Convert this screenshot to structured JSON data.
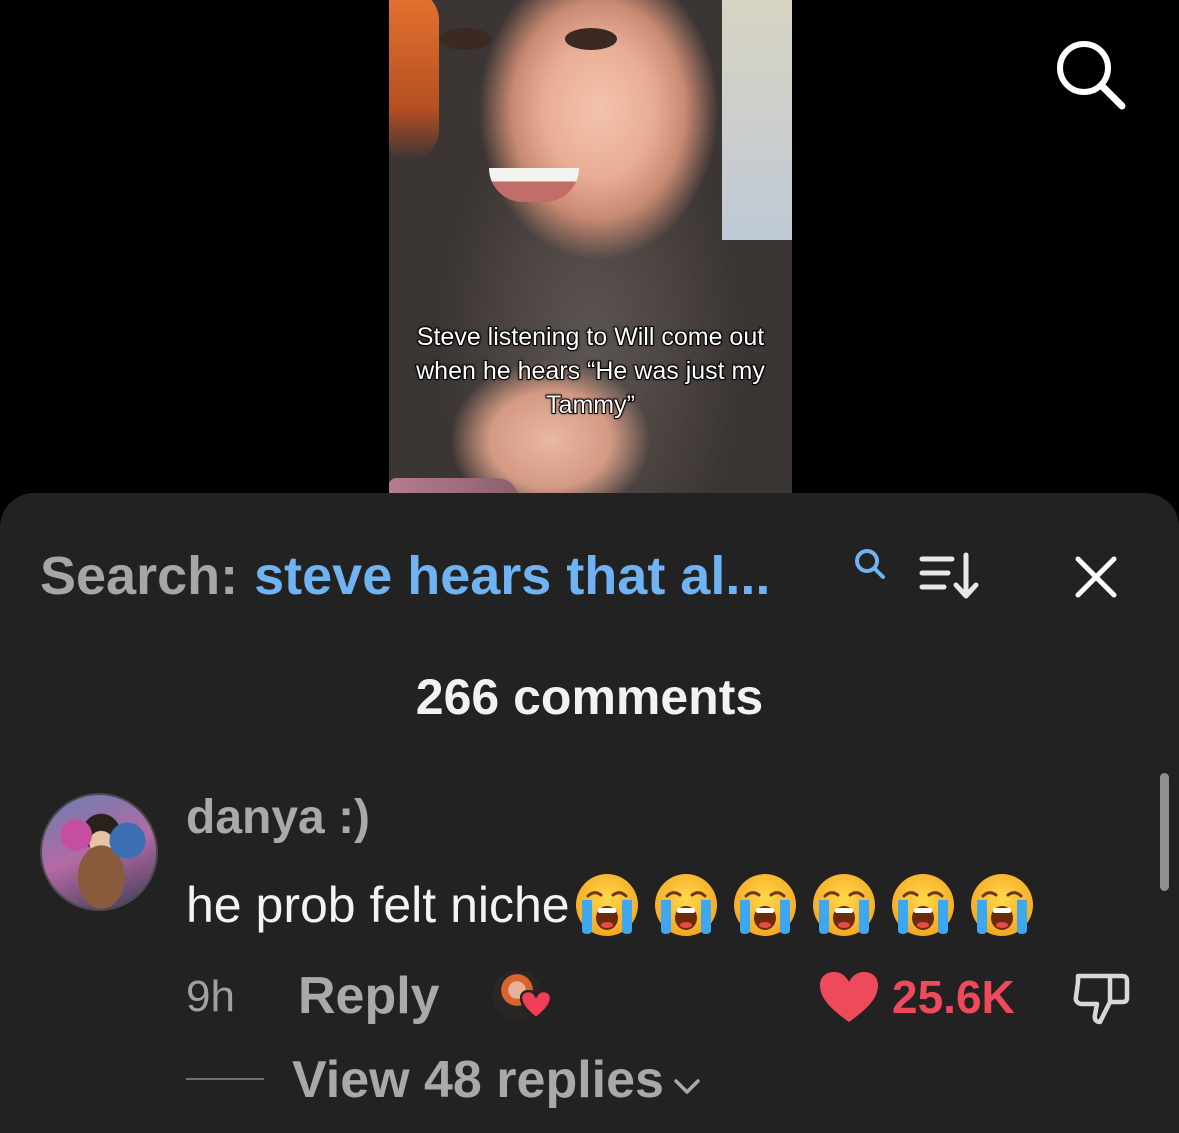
{
  "video": {
    "caption": "Steve listening to Will come out when he hears “He was just my Tammy”",
    "search_icon": "search-icon"
  },
  "comments_panel": {
    "search_label": "Search:",
    "search_query": "steve hears that al...",
    "search_icon": "search-icon",
    "sort_icon": "sort-icon",
    "close_icon": "close-icon",
    "comment_count": "266 comments"
  },
  "comment": {
    "username": "danya :)",
    "text": "he prob felt niche",
    "emoji": "loudly-crying-face",
    "emoji_count": 6,
    "time": "9h",
    "reply_label": "Reply",
    "like_count": "25.6K",
    "view_replies_label": "View 48 replies"
  },
  "colors": {
    "sheet_bg": "#222223",
    "accent_blue": "#6fb3f3",
    "like_red": "#ef4a5c",
    "muted_text": "#a9a9ab"
  }
}
